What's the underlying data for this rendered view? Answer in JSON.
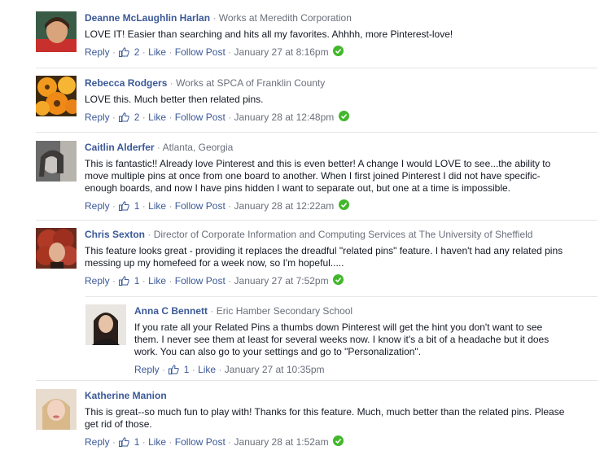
{
  "comments": [
    {
      "author": "Deanne McLaughlin Harlan",
      "meta": "Works at Meredith Corporation",
      "text": "LOVE IT! Easier than searching and hits all my favorites. Ahhhh, more Pinterest-love!",
      "likes": "2",
      "time": "January 27 at 8:16pm"
    },
    {
      "author": "Rebecca Rodgers",
      "meta": "Works at SPCA of Franklin County",
      "text": "LOVE this. Much better then related pins.",
      "likes": "2",
      "time": "January 28 at 12:48pm"
    },
    {
      "author": "Caitlin Alderfer",
      "meta": "Atlanta, Georgia",
      "text": "This is fantastic!! Already love Pinterest and this is even better! A change I would LOVE to see...the ability to move multiple pins at once from one board to another. When I first joined Pinterest I did not have specific-enough boards, and now I have pins hidden I want to separate out, but one at a time is impossible.",
      "likes": "1",
      "time": "January 28 at 12:22am"
    },
    {
      "author": "Chris Sexton",
      "meta": "Director of Corporate Information and Computing Services at The University of Sheffield",
      "text": "This feature looks great - providing it replaces the dreadful \"related pins\" feature. I haven't had any related pins messing up my homefeed for a week now, so I'm hopeful.....",
      "likes": "1",
      "time": "January 27 at 7:52pm"
    },
    {
      "author": "Anna C Bennett",
      "meta": "Eric Hamber Secondary School",
      "text": "If you rate all your Related Pins a thumbs down Pinterest will get the hint you don't want to see them. I never see them at least for several weeks now. I know it's a bit of a headache but it does work. You can also go to your settings and go to \"Personalization\".",
      "likes": "1",
      "time": "January 27 at 10:35pm"
    },
    {
      "author": "Katherine Manion",
      "meta": "",
      "text": "This is great--so much fun to play with! Thanks for this feature. Much, much better than the related pins. Please get rid of those.",
      "likes": "1",
      "time": "January 28 at 1:52am"
    }
  ],
  "labels": {
    "reply": "Reply",
    "like": "Like",
    "follow": "Follow Post",
    "sep": "·"
  },
  "colors": {
    "link": "#3b5998",
    "meta": "#9197a3",
    "check": "#42b72a",
    "divider": "#e5e5e5"
  }
}
